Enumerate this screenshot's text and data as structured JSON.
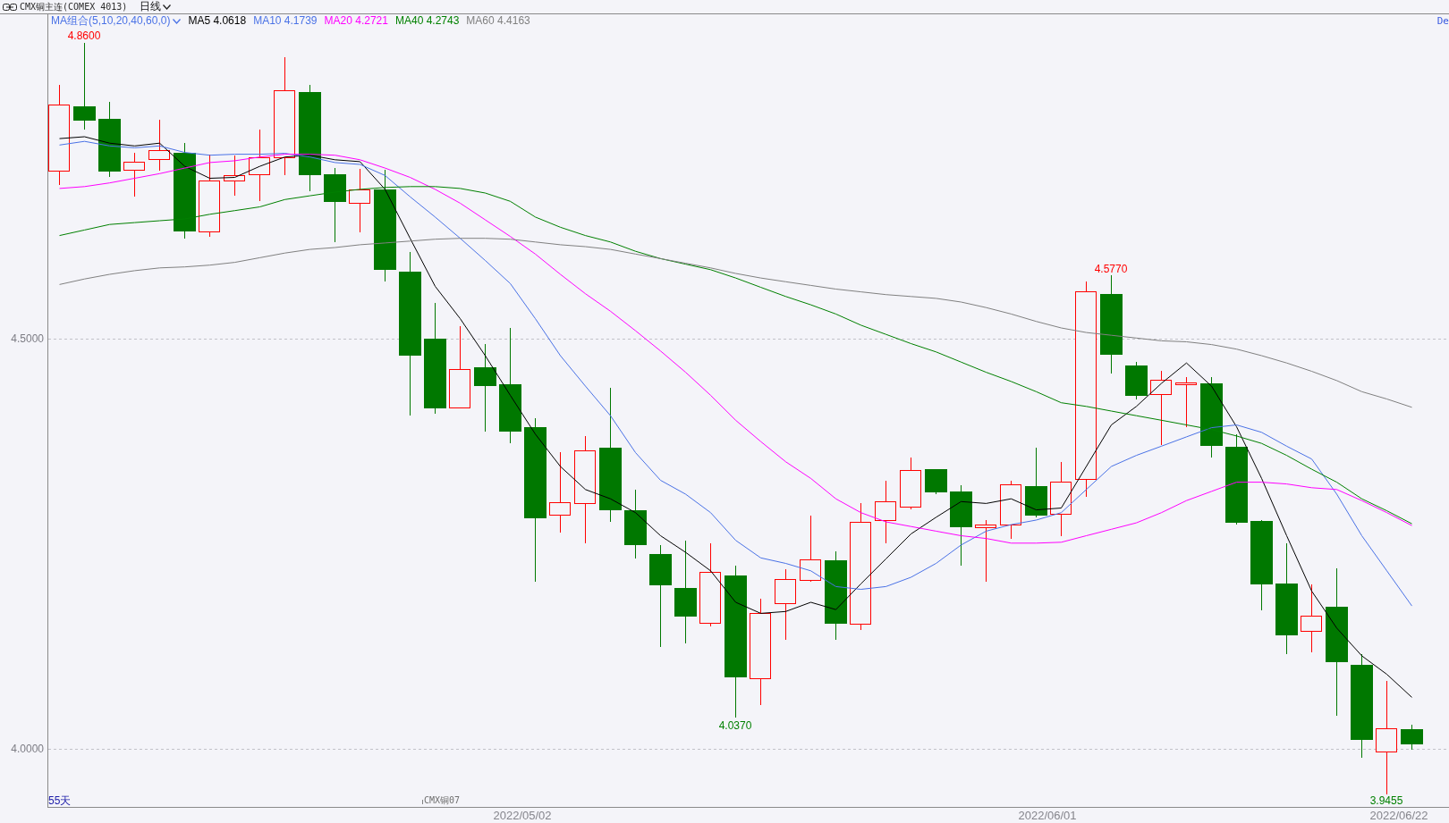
{
  "title_bar": {
    "title": "CMX铜主连(COMEX 4013)",
    "period": "日线"
  },
  "legend": {
    "group": "MA组合(5,10,20,40,60,0)",
    "items": [
      {
        "label": "MA5",
        "value": "4.0618",
        "color": "#000000"
      },
      {
        "label": "MA10",
        "value": "4.1739",
        "color": "#4a72e6"
      },
      {
        "label": "MA20",
        "value": "4.2721",
        "color": "#ff00ff"
      },
      {
        "label": "MA40",
        "value": "4.2743",
        "color": "#008000"
      },
      {
        "label": "MA60",
        "value": "4.4163",
        "color": "#808080"
      }
    ],
    "cut_label": "De"
  },
  "price_axis": {
    "labels": [
      "4.5000",
      "4.0000"
    ]
  },
  "price_labels": [
    {
      "text": "4.8600",
      "kind": "high"
    },
    {
      "text": "4.5770",
      "kind": "high"
    },
    {
      "text": "4.0370",
      "kind": "low"
    },
    {
      "text": "3.9455",
      "kind": "low"
    }
  ],
  "period_count": "55天",
  "contract": "CMX铜07",
  "date_axis": {
    "labels": [
      "2022/05/02",
      "2022/06/01",
      "2022/06/22"
    ]
  }
}
